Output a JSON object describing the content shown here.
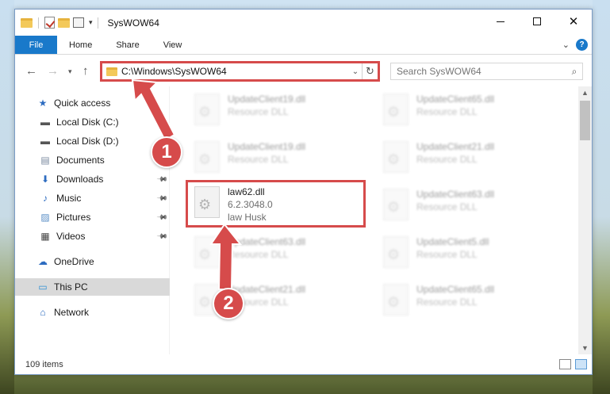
{
  "window": {
    "title": "SysWOW64",
    "caption": {
      "close": "✕"
    }
  },
  "ribbon": {
    "tabs": [
      "File",
      "Home",
      "Share",
      "View"
    ],
    "help": "?"
  },
  "address": {
    "path": "C:\\Windows\\SysWOW64"
  },
  "search": {
    "placeholder": "Search SysWOW64"
  },
  "sidebar": {
    "items": [
      {
        "label": "Quick access",
        "icon": "star-icon"
      },
      {
        "label": "Local Disk (C:)",
        "icon": "drive-icon",
        "pinned": true
      },
      {
        "label": "Local Disk (D:)",
        "icon": "drive-icon"
      },
      {
        "label": "Documents",
        "icon": "documents-icon"
      },
      {
        "label": "Downloads",
        "icon": "download-icon",
        "pinned": true
      },
      {
        "label": "Music",
        "icon": "music-icon",
        "pinned": true
      },
      {
        "label": "Pictures",
        "icon": "pictures-icon",
        "pinned": true
      },
      {
        "label": "Videos",
        "icon": "videos-icon",
        "pinned": true
      },
      {
        "label": "OneDrive",
        "icon": "cloud-icon"
      },
      {
        "label": "This PC",
        "icon": "computer-icon",
        "selected": true
      },
      {
        "label": "Network",
        "icon": "network-icon"
      }
    ]
  },
  "files": {
    "tiles": [
      {
        "name": "UpdateClient19.dll",
        "sub1": "Resource DLL",
        "blurred": true
      },
      {
        "name": "UpdateClient65.dll",
        "sub1": "Resource DLL",
        "blurred": true
      },
      {
        "name": "UpdateClient19.dll",
        "sub1": "Resource DLL",
        "blurred": true
      },
      {
        "name": "UpdateClient21.dll",
        "sub1": "Resource DLL",
        "blurred": true
      },
      {
        "name": "law62.dll",
        "sub1": "6.2.3048.0",
        "sub2": "law Husk",
        "highlighted": true
      },
      {
        "name": "UpdateClient63.dll",
        "sub1": "Resource DLL",
        "blurred": true
      },
      {
        "name": "UpdateClient63.dll",
        "sub1": "Resource DLL",
        "blurred": true
      },
      {
        "name": "UpdateClient5.dll",
        "sub1": "Resource DLL",
        "blurred": true
      },
      {
        "name": "UpdateClient21.dll",
        "sub1": "Resource DLL",
        "blurred": true
      },
      {
        "name": "UpdateClient65.dll",
        "sub1": "Resource DLL",
        "blurred": true
      }
    ]
  },
  "status": {
    "count": "109 items"
  },
  "annotations": {
    "step1": "1",
    "step2": "2",
    "color": "#d64b4b"
  }
}
